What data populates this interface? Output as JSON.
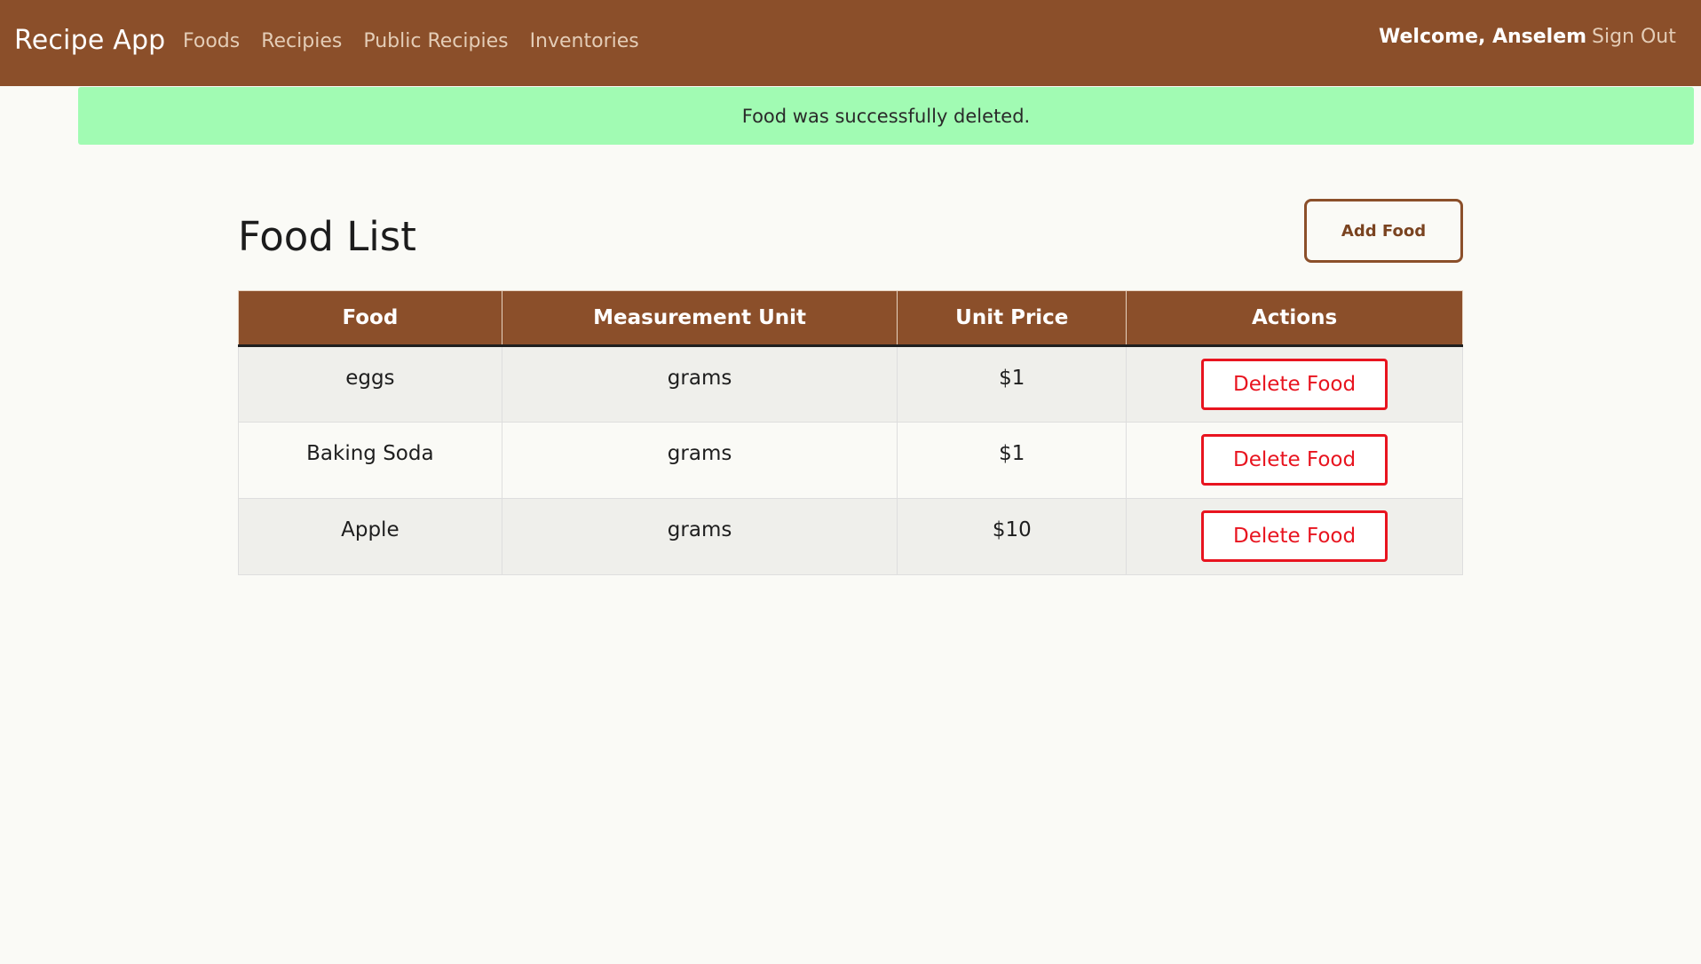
{
  "nav": {
    "brand": "Recipe App",
    "links": [
      "Foods",
      "Recipies",
      "Public Recipies",
      "Inventories"
    ],
    "welcome": "Welcome, Anselem",
    "sign_out": "Sign Out"
  },
  "flash": {
    "message": "Food was successfully deleted."
  },
  "main": {
    "title": "Food List",
    "add_button": "Add Food",
    "table": {
      "headers": [
        "Food",
        "Measurement Unit",
        "Unit Price",
        "Actions"
      ],
      "rows": [
        {
          "food": "eggs",
          "unit": "grams",
          "price": "$1",
          "action": "Delete Food"
        },
        {
          "food": "Baking Soda",
          "unit": "grams",
          "price": "$1",
          "action": "Delete Food"
        },
        {
          "food": "Apple",
          "unit": "grams",
          "price": "$10",
          "action": "Delete Food"
        }
      ]
    }
  },
  "colors": {
    "navbar": "#8b4f2a",
    "flash_bg": "#a1fbb3",
    "delete": "#e8141f"
  }
}
